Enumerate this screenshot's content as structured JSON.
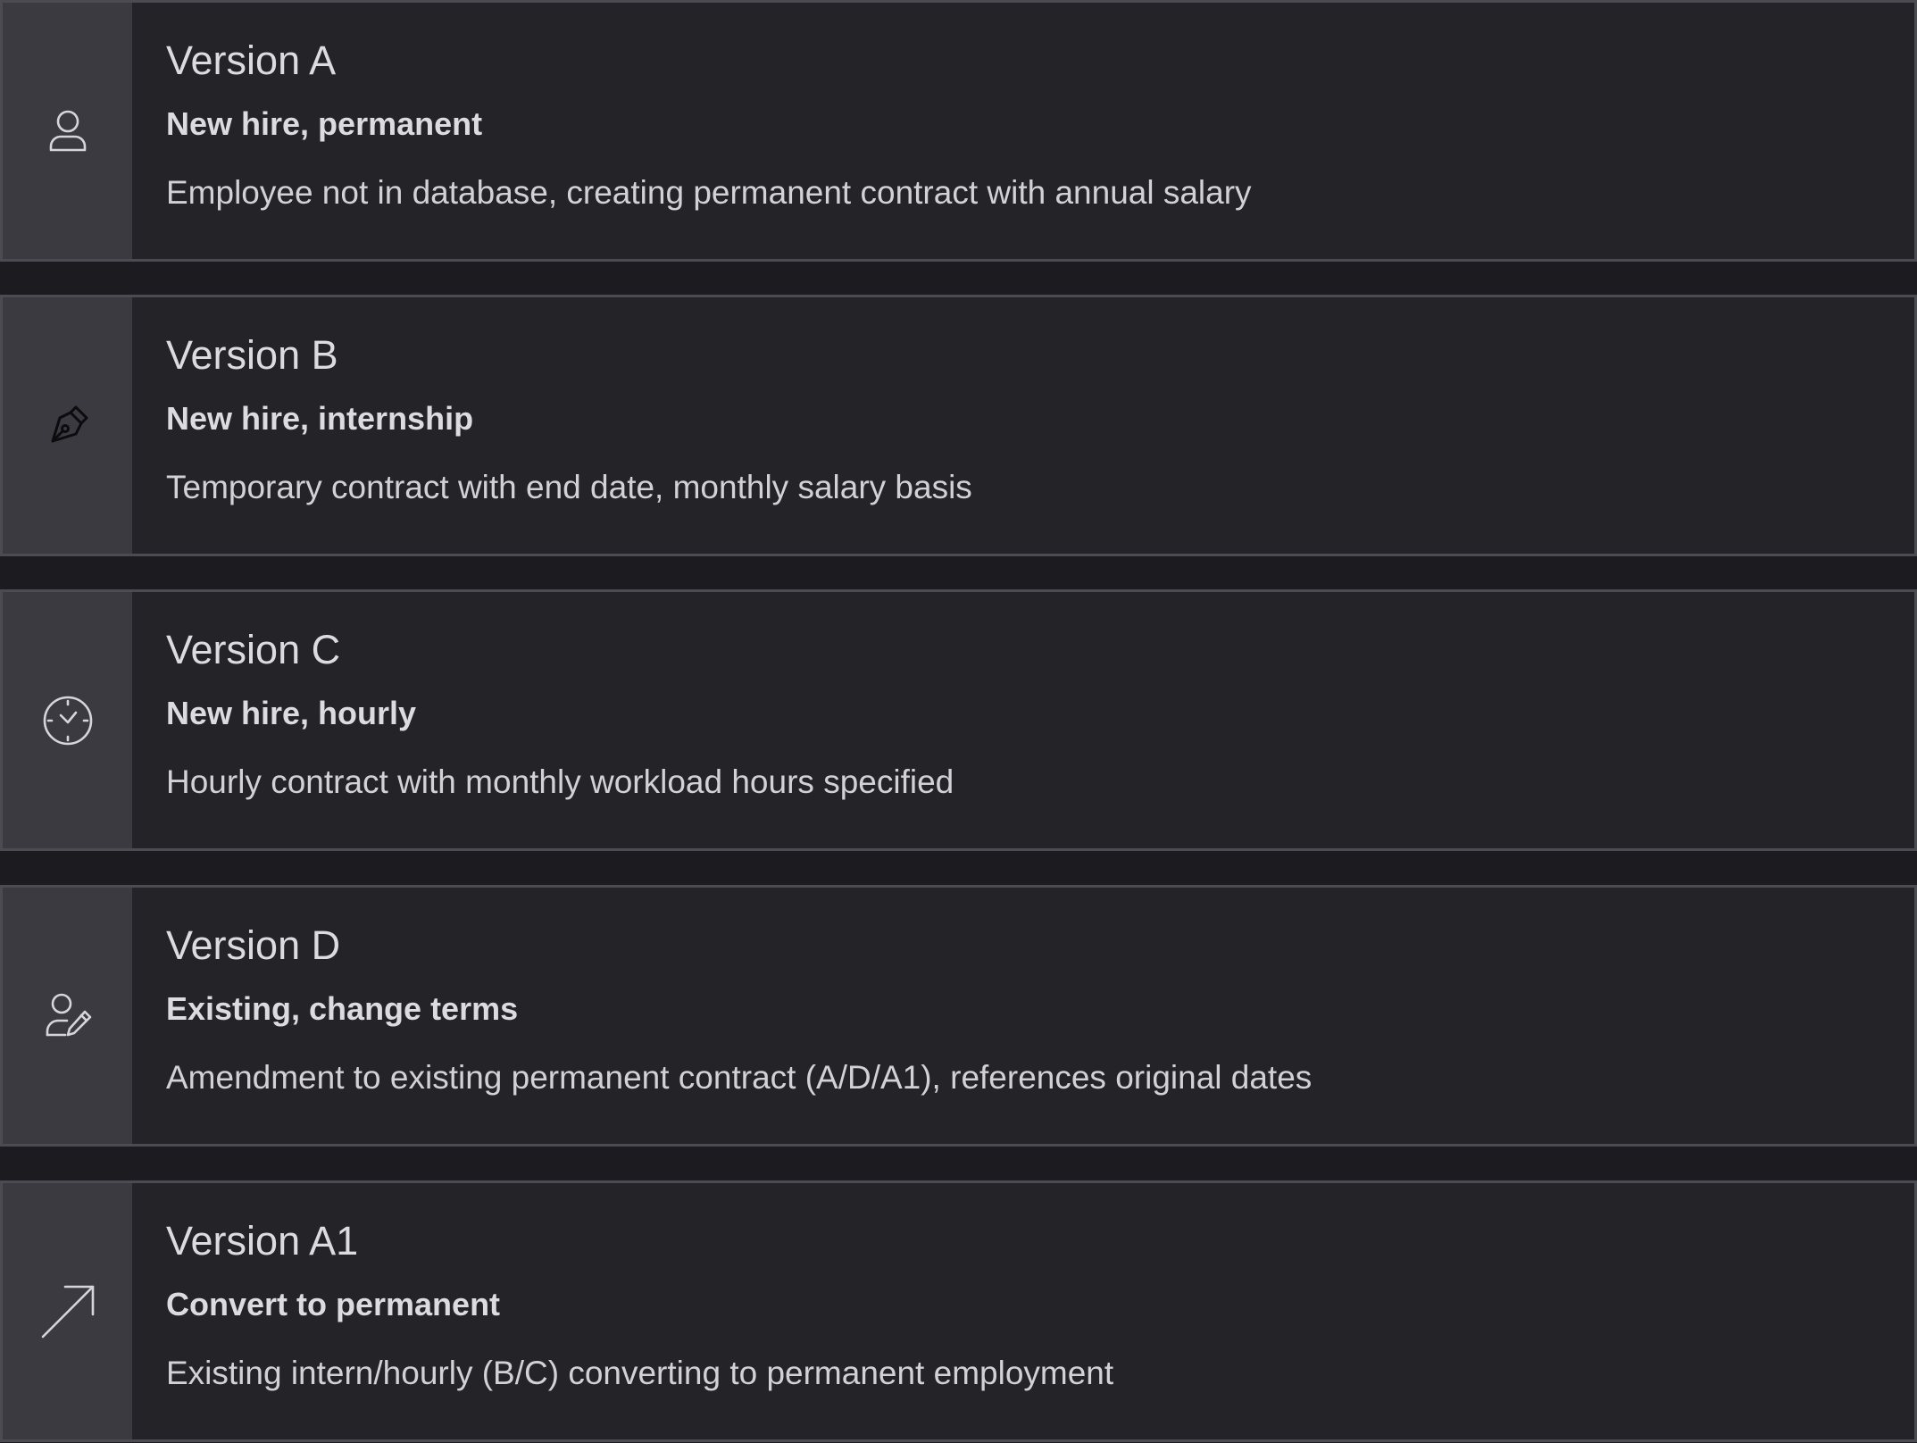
{
  "cards": [
    {
      "icon": "user-icon",
      "title": "Version A",
      "subtitle": "New hire, permanent",
      "description": "Employee not in database, creating permanent contract with annual salary"
    },
    {
      "icon": "pen-nib-icon",
      "title": "Version B",
      "subtitle": "New hire, internship",
      "description": "Temporary contract with end date, monthly salary basis"
    },
    {
      "icon": "clock-icon",
      "title": "Version C",
      "subtitle": "New hire, hourly",
      "description": "Hourly contract with monthly workload hours specified"
    },
    {
      "icon": "user-edit-icon",
      "title": "Version D",
      "subtitle": "Existing, change terms",
      "description": "Amendment to existing permanent contract (A/D/A1), references original dates"
    },
    {
      "icon": "arrow-up-right-icon",
      "title": "Version A1",
      "subtitle": "Convert to permanent",
      "description": "Existing intern/hourly (B/C) converting to permanent employment"
    }
  ]
}
